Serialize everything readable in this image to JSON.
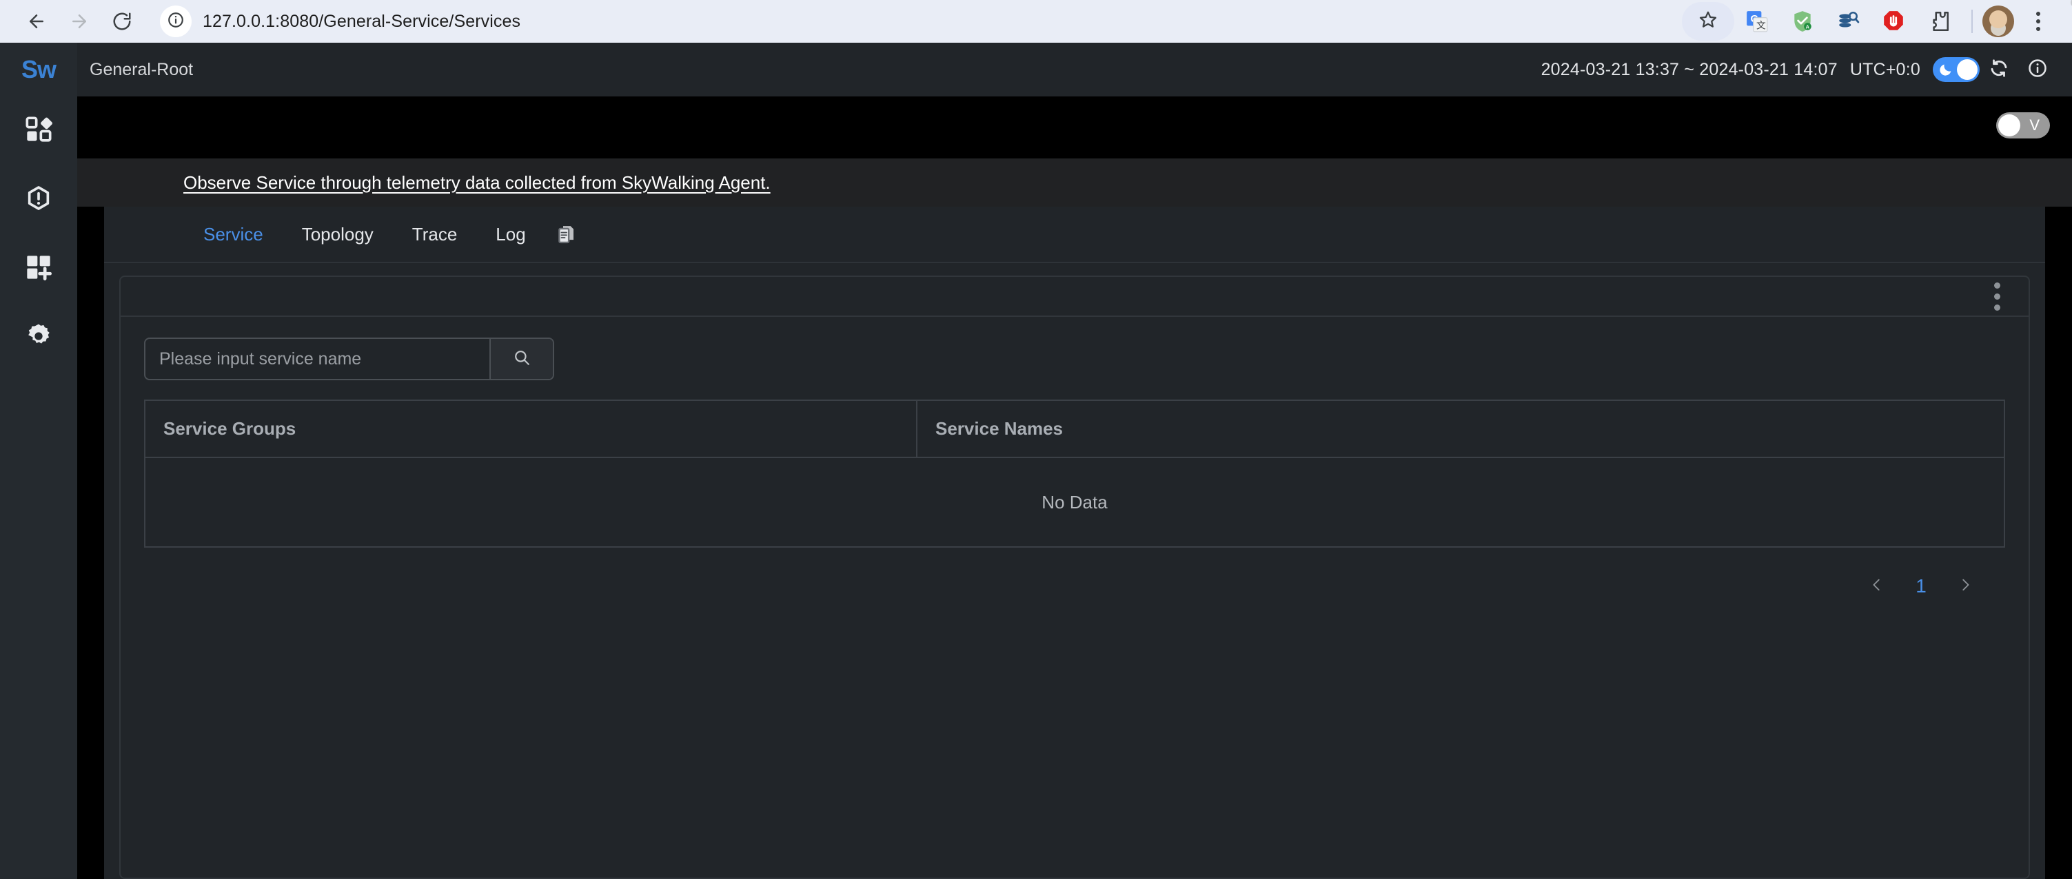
{
  "browser": {
    "back_icon": "back-arrow-icon",
    "forward_icon": "forward-arrow-icon",
    "reload_icon": "reload-icon",
    "site_info_icon": "site-info-icon",
    "url": "127.0.0.1:8080/General-Service/Services",
    "bookmark_icon": "star-icon",
    "extensions": [
      {
        "name": "google-translate-extension-icon"
      },
      {
        "name": "grammarly-extension-icon"
      },
      {
        "name": "json-viewer-extension-icon"
      },
      {
        "name": "adblock-extension-icon"
      },
      {
        "name": "extensions-puzzle-icon"
      }
    ],
    "avatar_icon": "profile-avatar",
    "menu_icon": "browser-menu-icon"
  },
  "sidebar": {
    "logo_text": "Sw",
    "items": [
      {
        "name": "dashboard",
        "icon": "dashboard-grid-icon"
      },
      {
        "name": "alarm",
        "icon": "alarm-hexagon-icon"
      },
      {
        "name": "new-dashboard",
        "icon": "add-dashboard-icon"
      },
      {
        "name": "settings",
        "icon": "gear-icon"
      }
    ]
  },
  "topbar": {
    "breadcrumb": "General-Root",
    "time_range": "2024-03-21 13:37 ~ 2024-03-21 14:07",
    "timezone": "UTC+0:0",
    "theme_toggle": {
      "icon": "moon-icon",
      "state": "on"
    },
    "refresh_icon": "refresh-icon",
    "info_icon": "info-icon"
  },
  "subbar": {
    "view_toggle": {
      "label": "V",
      "state": "off"
    }
  },
  "banner": {
    "text": "Observe Service through telemetry data collected from SkyWalking Agent."
  },
  "tabs": [
    {
      "label": "Service",
      "active": true
    },
    {
      "label": "Topology",
      "active": false
    },
    {
      "label": "Trace",
      "active": false
    },
    {
      "label": "Log",
      "active": false
    }
  ],
  "tab_extra_icon": "copy-dashboard-icon",
  "panel": {
    "menu_icon": "vertical-dots-icon",
    "search": {
      "placeholder": "Please input service name",
      "value": "",
      "button_icon": "search-icon"
    },
    "table": {
      "columns": [
        "Service Groups",
        "Service Names"
      ],
      "rows": [],
      "empty_text": "No Data"
    },
    "pagination": {
      "prev_icon": "chevron-left-icon",
      "next_icon": "chevron-right-icon",
      "current_page": "1"
    }
  },
  "colors": {
    "accent": "#4a90e8",
    "toggle_on": "#4090f7",
    "panel_bg": "#212529",
    "sidebar_bg": "#252a2f",
    "banner_bg": "#212224"
  }
}
